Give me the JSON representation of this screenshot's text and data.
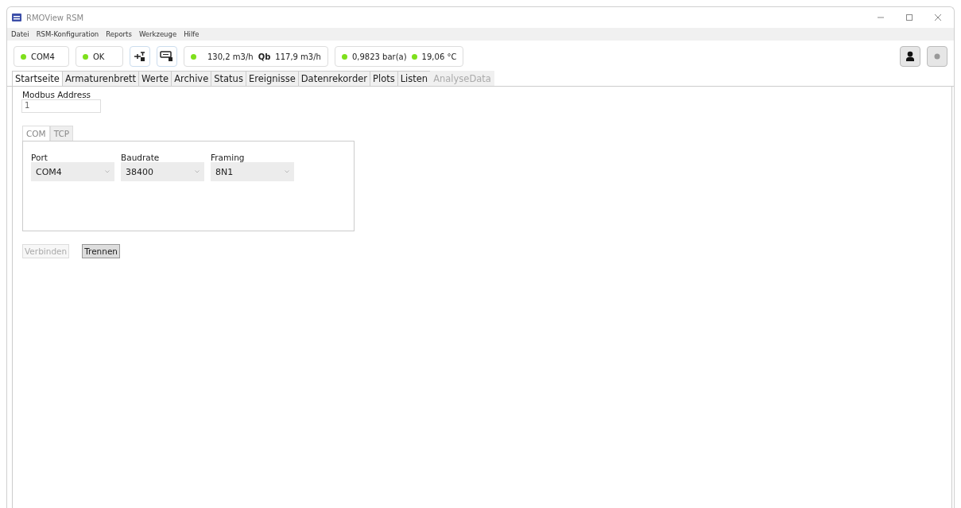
{
  "window": {
    "title": "RMOView RSM"
  },
  "menu": [
    "Datei",
    "RSM-Konfiguration",
    "Reports",
    "Werkzeuge",
    "Hilfe"
  ],
  "toolbar": {
    "status": [
      {
        "label": "COM4",
        "on": true
      },
      {
        "label": "OK",
        "on": true
      }
    ],
    "flow": {
      "on": true,
      "value": "130,2 m3/h",
      "qb_label": "Qb",
      "qb_value": "117,9 m3/h"
    },
    "pressure": {
      "on": true,
      "value": "0,9823 bar(a)"
    },
    "temperature": {
      "on": true,
      "value": "19,06 °C"
    }
  },
  "tabs": [
    {
      "label": "Startseite",
      "selected": true,
      "disabled": false
    },
    {
      "label": "Armaturenbrett",
      "selected": false,
      "disabled": false
    },
    {
      "label": "Werte",
      "selected": false,
      "disabled": false
    },
    {
      "label": "Archive",
      "selected": false,
      "disabled": false
    },
    {
      "label": "Status",
      "selected": false,
      "disabled": false
    },
    {
      "label": "Ereignisse",
      "selected": false,
      "disabled": false
    },
    {
      "label": "Datenrekorder",
      "selected": false,
      "disabled": false
    },
    {
      "label": "Plots",
      "selected": false,
      "disabled": false
    },
    {
      "label": "Listen",
      "selected": false,
      "disabled": false
    },
    {
      "label": "AnalyseData",
      "selected": false,
      "disabled": true
    }
  ],
  "modbus": {
    "label": "Modbus Address",
    "value": "1"
  },
  "connection_tabs": [
    {
      "label": "COM",
      "selected": true
    },
    {
      "label": "TCP",
      "selected": false
    }
  ],
  "fields": [
    {
      "label": "Port",
      "value": "COM4"
    },
    {
      "label": "Baudrate",
      "value": "38400"
    },
    {
      "label": "Framing",
      "value": "8N1"
    }
  ],
  "buttons": [
    {
      "label": "Verbinden",
      "disabled": true
    },
    {
      "label": "Trennen",
      "disabled": false
    }
  ]
}
